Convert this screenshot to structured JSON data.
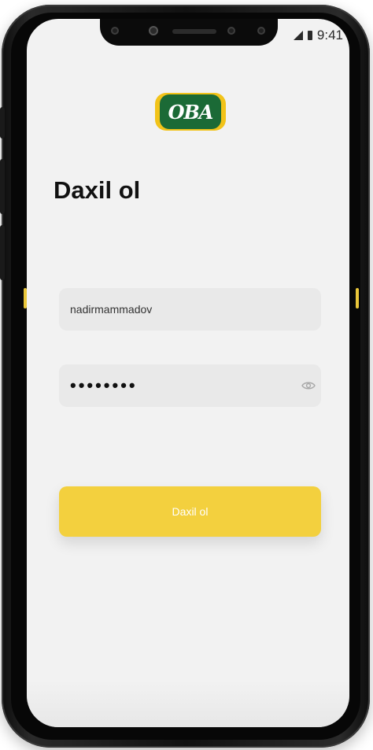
{
  "status_bar": {
    "time": "9:41"
  },
  "logo": {
    "text": "OBA",
    "colors": {
      "outer": "#f2c319",
      "inner": "#1b6a36"
    }
  },
  "login": {
    "title": "Daxil ol",
    "username": {
      "value": "nadirmammadov",
      "placeholder": ""
    },
    "password": {
      "value": "••••••••",
      "placeholder": ""
    },
    "submit_label": "Daxil ol"
  },
  "colors": {
    "accent": "#f3d03e",
    "screen_bg": "#f2f2f2",
    "field_bg": "#e9e9e9"
  },
  "icons": {
    "status_signal": "signal-icon",
    "status_battery": "battery-icon",
    "password_toggle": "eye-icon"
  }
}
